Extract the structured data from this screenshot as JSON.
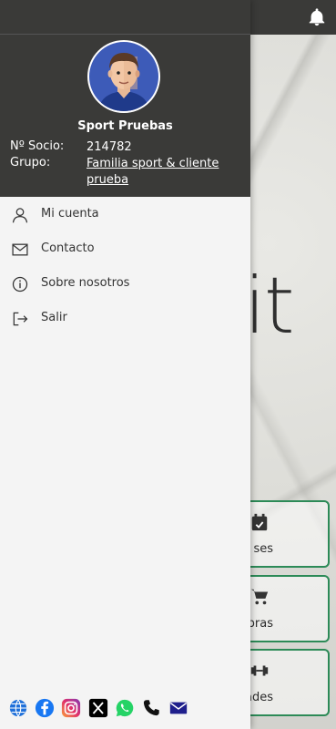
{
  "background": {
    "logo_fragment": "it",
    "tiles": [
      {
        "label": "ses",
        "icon": "calendar-icon"
      },
      {
        "label": "pras",
        "icon": "cart-icon"
      },
      {
        "label": "dades",
        "icon": "dumbbell-icon"
      }
    ]
  },
  "user": {
    "name": "Sport Pruebas",
    "member_label": "Nº Socio:",
    "member_number": "214782",
    "group_label": "Grupo:",
    "group_value": "Familia sport & cliente prueba"
  },
  "menu": [
    {
      "label": "Mi cuenta",
      "icon": "user-icon"
    },
    {
      "label": "Contacto",
      "icon": "mail-icon"
    },
    {
      "label": "Sobre nosotros",
      "icon": "info-icon"
    },
    {
      "label": "Salir",
      "icon": "logout-icon"
    }
  ],
  "social": [
    "globe-icon",
    "facebook-icon",
    "instagram-icon",
    "x-icon",
    "whatsapp-icon",
    "phone-icon",
    "mail-icon"
  ],
  "colors": {
    "header_bg": "#3a3a38",
    "drawer_bg": "#f4f4f4",
    "accent_green": "#2c8a57",
    "avatar_bg": "#3d5bb8"
  }
}
